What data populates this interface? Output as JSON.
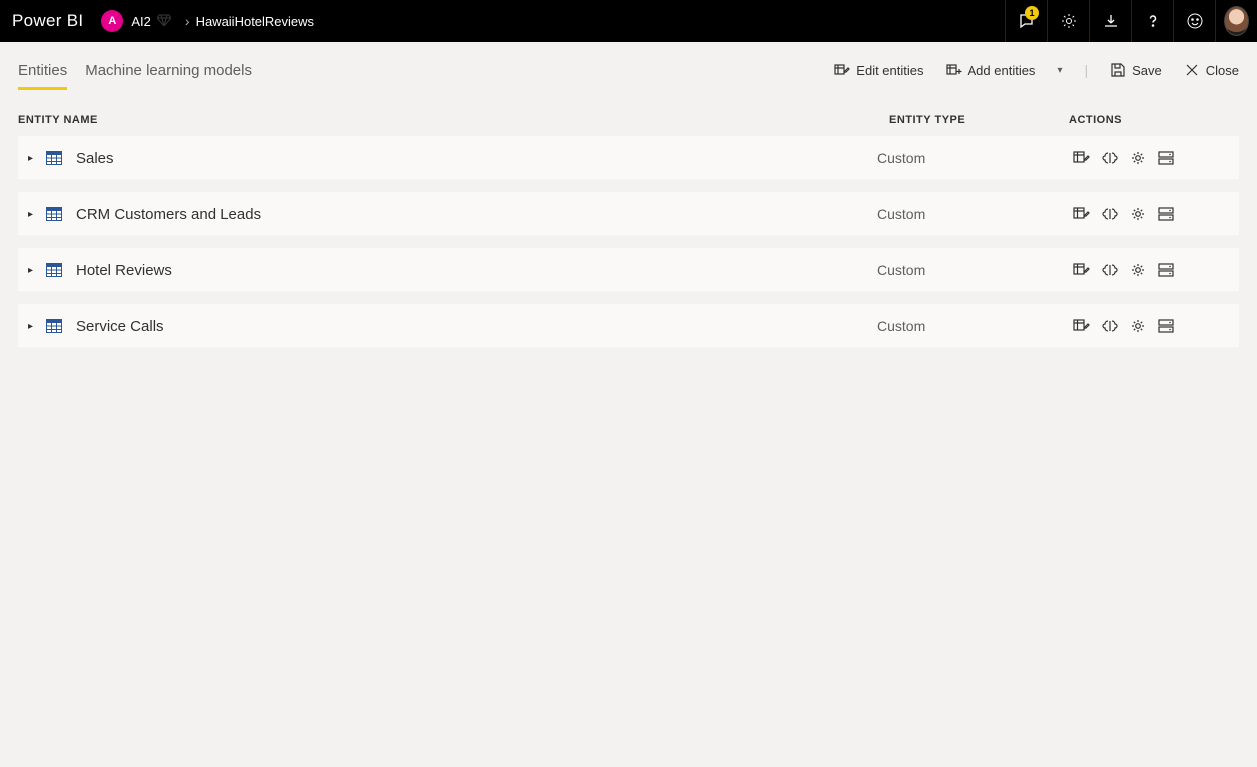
{
  "header": {
    "brand": "Power BI",
    "workspace_initial": "A",
    "workspace_name": "AI2",
    "breadcrumb_current": "HawaiiHotelReviews",
    "notif_count": "1"
  },
  "tabs": {
    "entities": "Entities",
    "ml_models": "Machine learning models"
  },
  "toolbar": {
    "edit_entities": "Edit entities",
    "add_entities": "Add entities",
    "save": "Save",
    "close": "Close"
  },
  "columns": {
    "name": "ENTITY NAME",
    "type": "ENTITY TYPE",
    "actions": "ACTIONS"
  },
  "entities": [
    {
      "name": "Sales",
      "type": "Custom"
    },
    {
      "name": "CRM Customers and Leads",
      "type": "Custom"
    },
    {
      "name": "Hotel Reviews",
      "type": "Custom"
    },
    {
      "name": "Service Calls",
      "type": "Custom"
    }
  ]
}
